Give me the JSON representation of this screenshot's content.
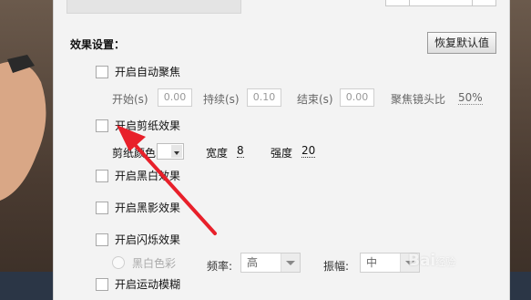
{
  "section_title": "效果设置：",
  "reset_button": "恢复默认值",
  "auto_focus": {
    "label": "开启自动聚焦",
    "start_label": "开始(s)",
    "start_value": "0.00",
    "duration_label": "持续(s)",
    "duration_value": "0.10",
    "end_label": "结束(s)",
    "end_value": "0.00",
    "ratio_label": "聚焦镜头比",
    "ratio_value": "50%"
  },
  "paper_cut": {
    "label": "开启剪纸效果",
    "color_label": "剪纸颜色",
    "width_label": "宽度",
    "width_value": "8",
    "strength_label": "强度",
    "strength_value": "20"
  },
  "black_white": {
    "label": "开启黑白效果"
  },
  "black_shadow": {
    "label": "开启黑影效果"
  },
  "flash": {
    "label": "开启闪烁效果",
    "bw_color_label": "黑白色彩",
    "freq_label": "频率:",
    "freq_value": "高",
    "amp_label": "振幅:",
    "amp_value": "中"
  },
  "motion_blur": {
    "label": "开启运动模糊"
  },
  "watermark": "Bai",
  "watermark_suffix": "经验",
  "colors": {
    "arrow": "#e8202a",
    "dialog_bg": "#f3f3f3"
  }
}
